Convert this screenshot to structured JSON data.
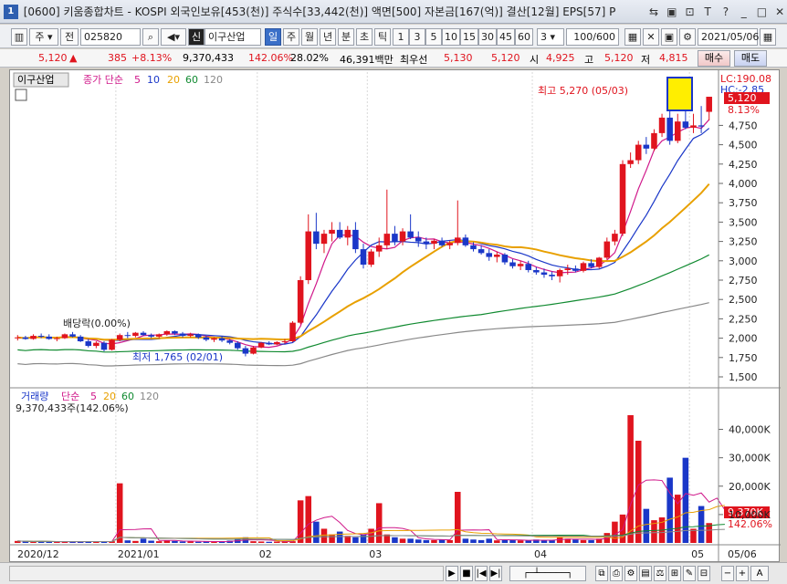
{
  "window": {
    "app_number": "1",
    "title": "[0600] 키움종합차트 - KOSPI 외국인보유[453(천)] 주식수[33,442(천)] 액면[500] 자본금[167(억)] 결산[12월] EPS[57] P",
    "buttons": [
      "⇆",
      "▣",
      "⊡",
      "T",
      "?",
      "_",
      "□",
      "✕"
    ]
  },
  "toolbar": {
    "period_main": "주",
    "period_compare": "전",
    "code": "025820",
    "badge": "신",
    "stock_name": "이구산업",
    "periods": [
      "일",
      "주",
      "월",
      "년",
      "분",
      "초",
      "틱"
    ],
    "selected_period": "일",
    "intervals": [
      "1",
      "3",
      "5",
      "10",
      "15",
      "30",
      "45",
      "60"
    ],
    "interval_value": "3",
    "count": "100/600",
    "date": "2021/05/06"
  },
  "pricebar": {
    "price": "5,120",
    "change": "385",
    "change_pct": "+8.13%",
    "volume": "9,370,433",
    "volume_ratio": "142.06%",
    "turnover": "28.02%",
    "amount": "46,391백만",
    "best_offer_label": "최우선",
    "best_offer": "5,130",
    "best_bid": "5,120",
    "open_label": "시",
    "open": "4,925",
    "high_label": "고",
    "high": "5,120",
    "low_label": "저",
    "low": "4,815",
    "buy_label": "매수",
    "sell_label": "매도"
  },
  "price_panel": {
    "stock_label": "이구산업",
    "legend_title": "종가 단순",
    "ma": [
      "5",
      "10",
      "20",
      "60",
      "120"
    ],
    "ma_colors": [
      "#d0188a",
      "#1a37c8",
      "#e8a000",
      "#108a30",
      "#888888"
    ],
    "lc_label": "LC:190.08",
    "hc_label": "HC:-2.85",
    "price_tag": "5,120",
    "pct_tag": "8.13%",
    "y_ticks": [
      "4,750",
      "4,500",
      "4,250",
      "4,000",
      "3,750",
      "3,500",
      "3,250",
      "3,000",
      "2,750",
      "2,500",
      "2,250",
      "2,000",
      "1,750",
      "1,500"
    ],
    "high_note": "최고 5,270 (05/03)",
    "low_note": "최저 1,765 (02/01)",
    "dividend_note": "배당락(0.00%)"
  },
  "volume_panel": {
    "title": "거래량",
    "legend_title": "단순",
    "ma": [
      "5",
      "20",
      "60",
      "120"
    ],
    "ma_colors": [
      "#d0188a",
      "#e8a000",
      "#108a30",
      "#888888"
    ],
    "info": "9,370,433주(142.06%)",
    "y_ticks": [
      "40,000K",
      "30,000K",
      "20,000K",
      "10,000K"
    ],
    "value_tag": "9,370K",
    "pct_tag": "142.06%"
  },
  "x_axis": [
    "2020/12",
    "2021/01",
    "02",
    "03",
    "04",
    "05",
    "05/06"
  ],
  "colors": {
    "up": "#e0141e",
    "down": "#1a37c8",
    "highlight": "#ffee00"
  },
  "chart_data": {
    "type": "candlestick",
    "candles": [
      [
        2000,
        2040,
        1970,
        2010
      ],
      [
        2010,
        2030,
        1980,
        1990
      ],
      [
        1990,
        2050,
        1980,
        2030
      ],
      [
        2030,
        2060,
        2000,
        2020
      ],
      [
        2020,
        2050,
        1980,
        1990
      ],
      [
        1990,
        2020,
        1960,
        2000
      ],
      [
        2000,
        2060,
        1990,
        2050
      ],
      [
        2050,
        2080,
        2010,
        2020
      ],
      [
        2020,
        2040,
        1950,
        1960
      ],
      [
        1960,
        1990,
        1880,
        1900
      ],
      [
        1900,
        1960,
        1870,
        1940
      ],
      [
        1940,
        1960,
        1830,
        1850
      ],
      [
        1850,
        1990,
        1840,
        1980
      ],
      [
        1980,
        2060,
        1960,
        2040
      ],
      [
        2040,
        2080,
        2000,
        2030
      ],
      [
        2030,
        2080,
        2010,
        2070
      ],
      [
        2070,
        2090,
        2030,
        2040
      ],
      [
        2040,
        2060,
        2000,
        2020
      ],
      [
        2020,
        2060,
        2000,
        2050
      ],
      [
        2050,
        2100,
        2030,
        2090
      ],
      [
        2090,
        2100,
        2040,
        2060
      ],
      [
        2060,
        2080,
        2010,
        2030
      ],
      [
        2030,
        2070,
        2010,
        2050
      ],
      [
        2050,
        2060,
        1990,
        2010
      ],
      [
        2010,
        2030,
        1960,
        1980
      ],
      [
        1980,
        2010,
        1950,
        2000
      ],
      [
        2000,
        2020,
        1950,
        1970
      ],
      [
        1970,
        1990,
        1920,
        1940
      ],
      [
        1940,
        1960,
        1850,
        1870
      ],
      [
        1870,
        1900,
        1765,
        1800
      ],
      [
        1800,
        1900,
        1790,
        1880
      ],
      [
        1880,
        1950,
        1870,
        1940
      ],
      [
        1940,
        1960,
        1910,
        1920
      ],
      [
        1920,
        1960,
        1910,
        1950
      ],
      [
        1950,
        1990,
        1930,
        1960
      ],
      [
        1960,
        2220,
        1950,
        2200
      ],
      [
        2200,
        2800,
        2180,
        2750
      ],
      [
        2750,
        3600,
        2700,
        3380
      ],
      [
        3380,
        3620,
        3150,
        3220
      ],
      [
        3220,
        3400,
        3100,
        3350
      ],
      [
        3350,
        3500,
        3250,
        3400
      ],
      [
        3400,
        3500,
        3280,
        3300
      ],
      [
        3300,
        3450,
        3200,
        3400
      ],
      [
        3400,
        3500,
        3100,
        3150
      ],
      [
        3150,
        3220,
        2900,
        2950
      ],
      [
        2950,
        3150,
        2920,
        3120
      ],
      [
        3120,
        3300,
        3050,
        3200
      ],
      [
        3200,
        3920,
        3150,
        3350
      ],
      [
        3350,
        3450,
        3200,
        3250
      ],
      [
        3250,
        3420,
        3200,
        3380
      ],
      [
        3380,
        3600,
        3280,
        3300
      ],
      [
        3300,
        3380,
        3180,
        3250
      ],
      [
        3250,
        3300,
        3150,
        3220
      ],
      [
        3220,
        3280,
        3150,
        3260
      ],
      [
        3260,
        3300,
        3180,
        3200
      ],
      [
        3200,
        3260,
        3150,
        3230
      ],
      [
        3230,
        3780,
        3200,
        3300
      ],
      [
        3300,
        3340,
        3180,
        3200
      ],
      [
        3200,
        3240,
        3120,
        3150
      ],
      [
        3150,
        3200,
        3080,
        3100
      ],
      [
        3100,
        3150,
        3000,
        3050
      ],
      [
        3050,
        3120,
        2980,
        3080
      ],
      [
        3080,
        3100,
        2950,
        2980
      ],
      [
        2980,
        3020,
        2900,
        2930
      ],
      [
        2930,
        3000,
        2880,
        2960
      ],
      [
        2960,
        3000,
        2850,
        2880
      ],
      [
        2880,
        2920,
        2820,
        2850
      ],
      [
        2850,
        2900,
        2780,
        2820
      ],
      [
        2820,
        2860,
        2750,
        2800
      ],
      [
        2800,
        2900,
        2720,
        2880
      ],
      [
        2880,
        2950,
        2820,
        2900
      ],
      [
        2900,
        2940,
        2850,
        2870
      ],
      [
        2870,
        2990,
        2850,
        2970
      ],
      [
        2970,
        3020,
        2900,
        2920
      ],
      [
        2920,
        3050,
        2900,
        3040
      ],
      [
        3040,
        3300,
        3020,
        3250
      ],
      [
        3250,
        3400,
        3200,
        3350
      ],
      [
        3350,
        4300,
        3320,
        4250
      ],
      [
        4250,
        4400,
        4200,
        4300
      ],
      [
        4300,
        4550,
        4250,
        4500
      ],
      [
        4500,
        4600,
        4380,
        4450
      ],
      [
        4450,
        4700,
        4420,
        4650
      ],
      [
        4650,
        4900,
        4600,
        4850
      ],
      [
        4850,
        5270,
        4500,
        4550
      ],
      [
        4550,
        4900,
        4520,
        4800
      ],
      [
        4800,
        5200,
        4700,
        4720
      ],
      [
        4720,
        4900,
        4650,
        4750
      ],
      [
        4750,
        5000,
        4650,
        4735
      ],
      [
        4925,
        5120,
        4815,
        5120
      ]
    ],
    "volume_k": [
      700,
      500,
      400,
      600,
      400,
      350,
      500,
      400,
      500,
      600,
      500,
      450,
      600,
      21000,
      900,
      700,
      1500,
      800,
      600,
      900,
      700,
      500,
      600,
      400,
      500,
      400,
      600,
      800,
      1500,
      2000,
      600,
      500,
      400,
      500,
      500,
      600,
      15000,
      16500,
      7500,
      5000,
      3000,
      4000,
      2500,
      2000,
      3000,
      5000,
      14000,
      3000,
      2000,
      1500,
      1500,
      1200,
      1000,
      1000,
      1200,
      1000,
      18000,
      1500,
      1200,
      1000,
      1500,
      900,
      1000,
      1000,
      900,
      800,
      1200,
      900,
      1000,
      2000,
      1500,
      1200,
      1000,
      1000,
      1500,
      3500,
      7500,
      10000,
      45000,
      36000,
      12000,
      8000,
      9000,
      23000,
      17000,
      30000,
      5000,
      13000,
      7000,
      24000,
      9370
    ]
  }
}
